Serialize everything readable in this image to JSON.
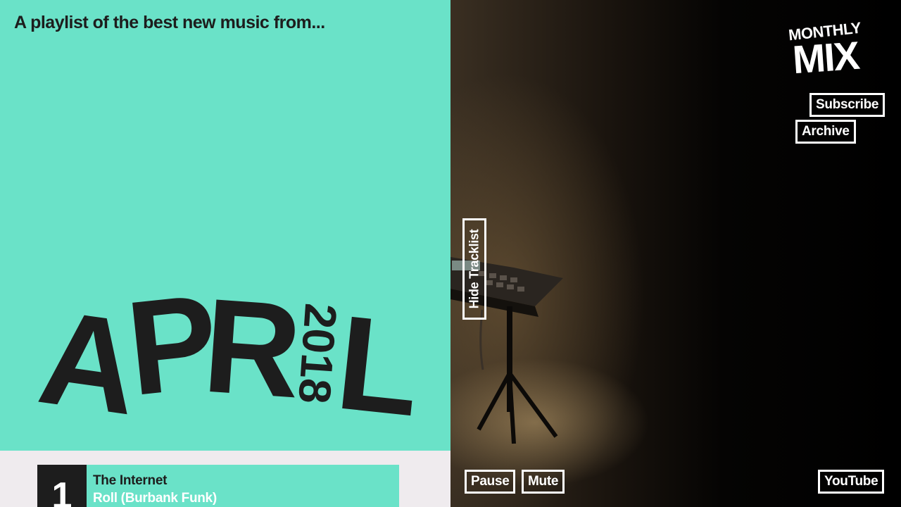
{
  "intro": {
    "text": "A playlist of the best new music from..."
  },
  "month": {
    "letters": [
      "A",
      "P",
      "R",
      "L"
    ],
    "year": "2018"
  },
  "tracklist": {
    "tracks": [
      {
        "number": "1",
        "artist": "The Internet",
        "title": "Roll (Burbank Funk)"
      }
    ]
  },
  "logo": {
    "top": "MONTHLY",
    "bottom": "MIX"
  },
  "nav": {
    "subscribe": "Subscribe",
    "archive": "Archive"
  },
  "controls": {
    "hide_tracklist": "Hide Tracklist",
    "pause": "Pause",
    "mute": "Mute",
    "youtube": "YouTube"
  },
  "colors": {
    "accent": "#6ae2c8",
    "ink": "#1d1d1d",
    "track_bg": "#efebee"
  }
}
